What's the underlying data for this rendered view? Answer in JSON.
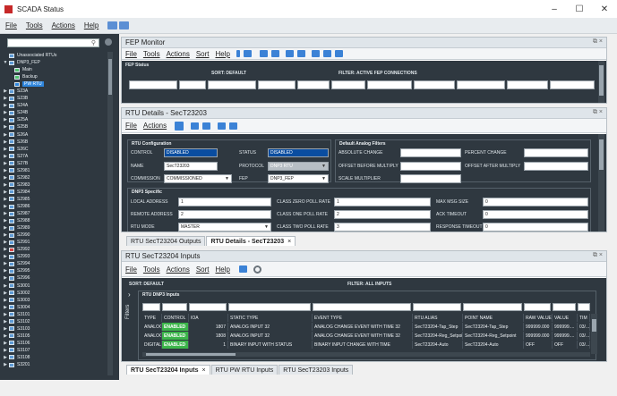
{
  "window": {
    "title": "SCADA Status",
    "min": "–",
    "max": "☐",
    "close": "✕"
  },
  "menu": {
    "file": "File",
    "tools": "Tools",
    "actions": "Actions",
    "help": "Help"
  },
  "tree": {
    "items": [
      {
        "label": "Unassociated RTUs",
        "level": 0,
        "arrow": "",
        "icon": "b"
      },
      {
        "label": "DNP3_FEP",
        "level": 0,
        "arrow": "▼",
        "icon": "b"
      },
      {
        "label": "Main",
        "level": 1,
        "arrow": "",
        "icon": "g"
      },
      {
        "label": "Backup",
        "level": 1,
        "arrow": "",
        "icon": "g"
      },
      {
        "label": "PW RTU",
        "level": 1,
        "arrow": "",
        "icon": "b",
        "selected": true
      },
      {
        "label": "S23A",
        "level": 1,
        "arrow": "▶",
        "icon": "b"
      },
      {
        "label": "S23B",
        "level": 1,
        "arrow": "▶",
        "icon": "b"
      },
      {
        "label": "S24A",
        "level": 1,
        "arrow": "▶",
        "icon": "b"
      },
      {
        "label": "S24B",
        "level": 1,
        "arrow": "▶",
        "icon": "b"
      },
      {
        "label": "S25A",
        "level": 1,
        "arrow": "▶",
        "icon": "b"
      },
      {
        "label": "S25B",
        "level": 1,
        "arrow": "▶",
        "icon": "b"
      },
      {
        "label": "S26A",
        "level": 1,
        "arrow": "▶",
        "icon": "b"
      },
      {
        "label": "S26B",
        "level": 1,
        "arrow": "▶",
        "icon": "b"
      },
      {
        "label": "S26C",
        "level": 1,
        "arrow": "▶",
        "icon": "b"
      },
      {
        "label": "S27A",
        "level": 1,
        "arrow": "▶",
        "icon": "b"
      },
      {
        "label": "S27B",
        "level": 1,
        "arrow": "▶",
        "icon": "b"
      },
      {
        "label": "S2981",
        "level": 1,
        "arrow": "▶",
        "icon": "b"
      },
      {
        "label": "S2982",
        "level": 1,
        "arrow": "▶",
        "icon": "b"
      },
      {
        "label": "S2983",
        "level": 1,
        "arrow": "▶",
        "icon": "b"
      },
      {
        "label": "S2984",
        "level": 1,
        "arrow": "▶",
        "icon": "b"
      },
      {
        "label": "S2985",
        "level": 1,
        "arrow": "▶",
        "icon": "b"
      },
      {
        "label": "S2986",
        "level": 1,
        "arrow": "▶",
        "icon": "b"
      },
      {
        "label": "S2987",
        "level": 1,
        "arrow": "▶",
        "icon": "b"
      },
      {
        "label": "S2988",
        "level": 1,
        "arrow": "▶",
        "icon": "b"
      },
      {
        "label": "S2989",
        "level": 1,
        "arrow": "▶",
        "icon": "b"
      },
      {
        "label": "S2990",
        "level": 1,
        "arrow": "▶",
        "icon": "b"
      },
      {
        "label": "S2991",
        "level": 1,
        "arrow": "▶",
        "icon": "b"
      },
      {
        "label": "S2992",
        "level": 1,
        "arrow": "▶",
        "icon": "r"
      },
      {
        "label": "S2993",
        "level": 1,
        "arrow": "▶",
        "icon": "b"
      },
      {
        "label": "S2994",
        "level": 1,
        "arrow": "▶",
        "icon": "b"
      },
      {
        "label": "S2995",
        "level": 1,
        "arrow": "▶",
        "icon": "b"
      },
      {
        "label": "S2996",
        "level": 1,
        "arrow": "▶",
        "icon": "b"
      },
      {
        "label": "S3001",
        "level": 1,
        "arrow": "▶",
        "icon": "b"
      },
      {
        "label": "S3002",
        "level": 1,
        "arrow": "▶",
        "icon": "b"
      },
      {
        "label": "S3003",
        "level": 1,
        "arrow": "▶",
        "icon": "b"
      },
      {
        "label": "S3004",
        "level": 1,
        "arrow": "▶",
        "icon": "b"
      },
      {
        "label": "S3101",
        "level": 1,
        "arrow": "▶",
        "icon": "b"
      },
      {
        "label": "S3102",
        "level": 1,
        "arrow": "▶",
        "icon": "b"
      },
      {
        "label": "S3103",
        "level": 1,
        "arrow": "▶",
        "icon": "b"
      },
      {
        "label": "S3105",
        "level": 1,
        "arrow": "▶",
        "icon": "b"
      },
      {
        "label": "S3106",
        "level": 1,
        "arrow": "▶",
        "icon": "b"
      },
      {
        "label": "S3107",
        "level": 1,
        "arrow": "▶",
        "icon": "b"
      },
      {
        "label": "S3108",
        "level": 1,
        "arrow": "▶",
        "icon": "b"
      },
      {
        "label": "S3201",
        "level": 1,
        "arrow": "▶",
        "icon": "b"
      }
    ]
  },
  "fep": {
    "title": "FEP Monitor",
    "menu": [
      "File",
      "Tools",
      "Actions",
      "Sort",
      "Help"
    ],
    "status_label": "FEP Status",
    "sort": "SORT: DEFAULT",
    "filter": "FILTER: ACTIVE FEP CONNECTIONS"
  },
  "rtu": {
    "title": "RTU Details - SecT23203",
    "menu": [
      "File",
      "Actions"
    ],
    "config_title": "RTU Configuration",
    "control_label": "CONTROL",
    "control_value": "DISABLED",
    "status_label": "STATUS",
    "status_value": "DISABLED",
    "name_label": "NAME",
    "name_value": "SecT23203",
    "protocol_label": "PROTOCOL",
    "protocol_value": "DNP3 RTU",
    "commission_label": "COMMISSION",
    "commission_value": "COMMISSIONED",
    "fep_label": "FEP",
    "fep_value": "DNP3_FEP",
    "analog_title": "Default Analog Filters",
    "abs_change": "ABSOLUTE CHANGE",
    "pct_change": "PERCENT CHANGE",
    "offset_before": "OFFSET BEFORE MULTIPLY",
    "offset_after": "OFFSET AFTER MULTIPLY",
    "scale": "SCALE MULTIPLIER",
    "dnp3_title": "DNP3 Specific",
    "local_label": "LOCAL ADDRESS",
    "local_value": "1",
    "remote_label": "REMOTE ADDRESS",
    "remote_value": "2",
    "mode_label": "RTU MODE",
    "mode_value": "MASTER",
    "class0_label": "CLASS ZERO POLL RATE",
    "class0_value": "1",
    "class1_label": "CLASS ONE POLL RATE",
    "class1_value": "2",
    "class2_label": "CLASS TWO POLL RATE",
    "class2_value": "3",
    "maxmsg_label": "MAX MSG SIZE",
    "maxmsg_value": "0",
    "ack_label": "ACK TIMEOUT",
    "ack_value": "0",
    "resp_label": "RESPONSE TIMEOUT",
    "resp_value": "0"
  },
  "mid_tabs": {
    "tab1": "RTU SecT23204 Outputs",
    "tab2": "RTU Details - SecT23203",
    "x": "×"
  },
  "inputs": {
    "title": "RTU SecT23204 Inputs",
    "menu": [
      "File",
      "Tools",
      "Actions",
      "Sort",
      "Help"
    ],
    "sort": "SORT: DEFAULT",
    "filter": "FILTER: ALL INPUTS",
    "section": "RTU DNP3 Inputs",
    "filters_label": "Filters",
    "columns": [
      "TYPE",
      "CONTROL",
      "IOA",
      "STATIC TYPE",
      "EVENT TYPE",
      "RTU ALIAS",
      "POINT NAME",
      "RAW VALUE",
      "VALUE",
      "TIM"
    ],
    "rows": [
      [
        "ANALOG",
        "ENABLED",
        "1807",
        "ANALOG INPUT 32",
        "ANALOG CHANGE EVENT WITH TIME 32",
        "SecT23204-Tap_Step",
        "SecT23204-Tap_Step",
        "999999.000",
        "999999....",
        "03/..."
      ],
      [
        "ANALOG",
        "ENABLED",
        "1808",
        "ANALOG INPUT 32",
        "ANALOG CHANGE EVENT WITH TIME 32",
        "SecT23204-Reg_Setpoint",
        "SecT23204-Reg_Setpoint",
        "999999.000",
        "999999....",
        "03/..."
      ],
      [
        "DIGITAL",
        "ENABLED",
        "1",
        "BINARY INPUT WITH STATUS",
        "BINARY INPUT CHANGE WITH TIME",
        "SecT23204-Auto",
        "SecT23204-Auto",
        "OFF",
        "OFF",
        "03/..."
      ]
    ]
  },
  "bottom_tabs": {
    "tab1": "RTU SecT23204 Inputs",
    "tab2": "RTU PW RTU Inputs",
    "tab3": "RTU SecT23203 Inputs",
    "x": "×"
  }
}
